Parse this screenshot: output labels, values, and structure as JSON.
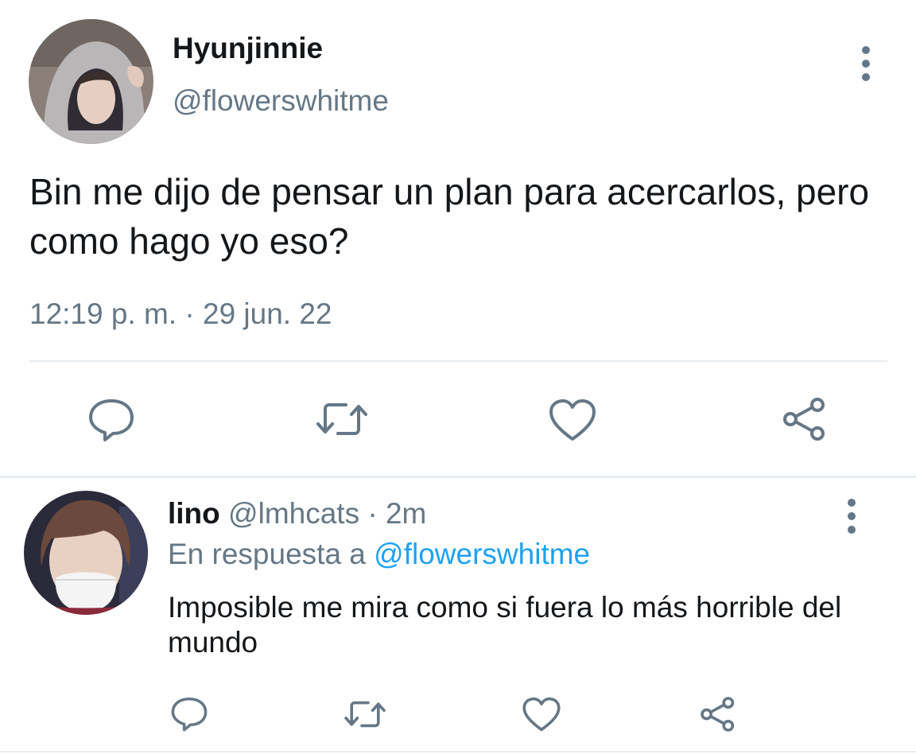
{
  "tweet": {
    "display_name": "Hyunjinnie",
    "handle": "@flowerswhitme",
    "text": "Bin me dijo de pensar un plan para acercarlos, pero como hago yo eso?",
    "timestamp": "12:19 p. m. · 29 jun. 22",
    "avatar_icon": "profile-photo",
    "more_icon": "more-vertical-icon",
    "actions": [
      "reply-icon",
      "retweet-icon",
      "like-icon",
      "share-icon"
    ]
  },
  "reply": {
    "display_name": "lino",
    "meta": "@lmhcats · 2m",
    "in_reply_prefix": "En respuesta a",
    "in_reply_handle": "@flowerswhitme",
    "text": "Imposible me mira como si fuera lo más horrible del mundo",
    "avatar_icon": "profile-photo",
    "more_icon": "more-vertical-icon",
    "actions": [
      "reply-icon",
      "retweet-icon",
      "like-icon",
      "share-icon"
    ]
  },
  "colors": {
    "text_primary": "#14171a",
    "text_secondary": "#657786",
    "link": "#1da1f2",
    "divider": "#e6ecf0"
  }
}
